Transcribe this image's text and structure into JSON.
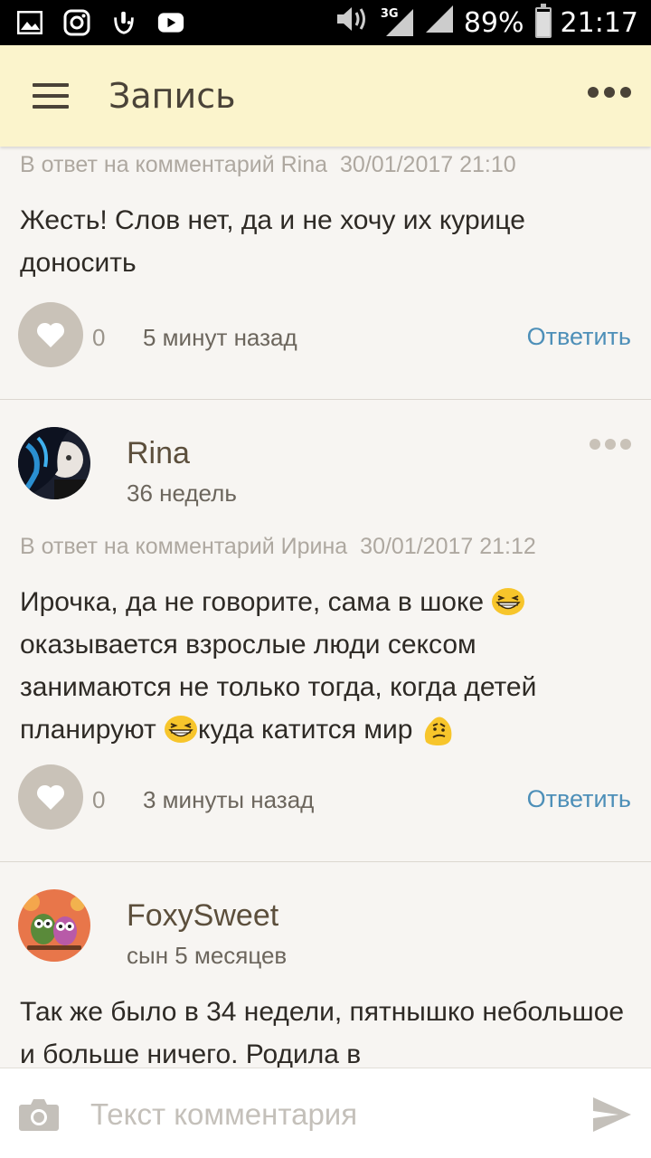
{
  "status_bar": {
    "network": "3G",
    "battery_percent": "89%",
    "battery_level": 0.89,
    "time": "21:17",
    "left_icons": [
      "image-icon",
      "instagram-icon",
      "touchpal-icon",
      "youtube-icon"
    ],
    "right_icons": [
      "volume-icon",
      "signal-3g-icon",
      "signal-icon",
      "battery-icon"
    ]
  },
  "app_bar": {
    "title": "Запись",
    "menu_icon": "hamburger-icon",
    "more_icon": "more-dots-icon"
  },
  "comments": [
    {
      "reply_to": "В ответ на комментарий Rina",
      "reply_date": "30/01/2017 21:10",
      "text": "Жесть! Слов нет, да и не хочу их курице доносить",
      "likes": "0",
      "time_ago": "5 минут назад",
      "reply_label": "Ответить"
    },
    {
      "author": "Rina",
      "author_sub": "36 недель",
      "reply_to": "В ответ на комментарий Ирина",
      "reply_date": "30/01/2017 21:12",
      "text_parts": [
        "Ирочка, да не говорите, сама в шоке ",
        "оказывается взрослые люди сексом занимаются не только тогда, когда детей планируют ",
        "куда катится мир "
      ],
      "emojis": [
        "laughing-emoji",
        "laughing-emoji",
        "confused-emoji"
      ],
      "likes": "0",
      "time_ago": "3 минуты назад",
      "reply_label": "Ответить"
    },
    {
      "author": "FoxySweet",
      "author_sub": "сын 5 месяцев",
      "text": "Так же было в 34 недели, пятнышко небольшое и больше ничего. Родила в"
    }
  ],
  "input_bar": {
    "placeholder": "Текст комментария",
    "camera_icon": "camera-icon",
    "send_icon": "send-icon"
  },
  "colors": {
    "app_bar_bg": "#fbf4cc",
    "page_bg": "#f7f5f2",
    "accent_link": "#4d8fb8",
    "like_button": "#c9c2b8",
    "author_name": "#5c4f3c"
  }
}
